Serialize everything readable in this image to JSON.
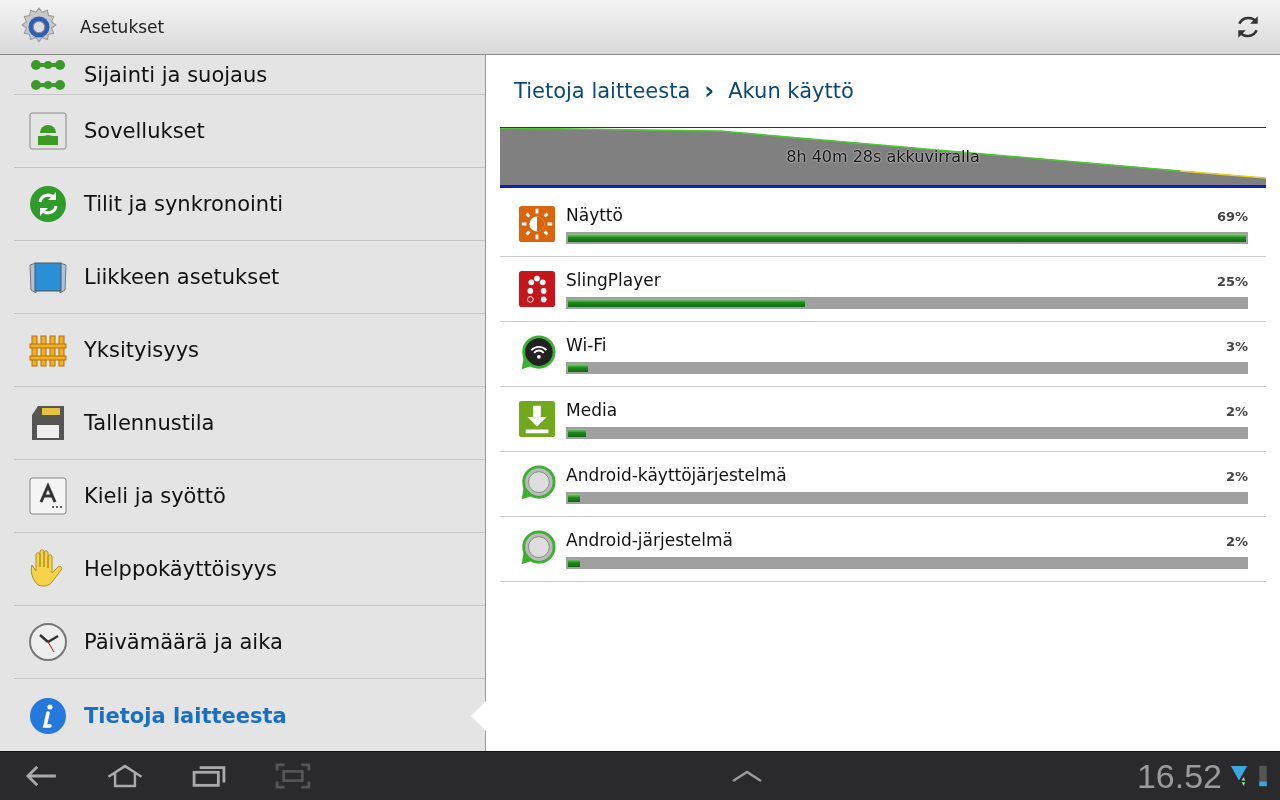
{
  "action_bar": {
    "title": "Asetukset"
  },
  "sidebar": {
    "items": [
      {
        "label": "Sijainti ja suojaus",
        "selected": false
      },
      {
        "label": "Sovellukset",
        "selected": false
      },
      {
        "label": "Tilit ja synkronointi",
        "selected": false
      },
      {
        "label": "Liikkeen asetukset",
        "selected": false
      },
      {
        "label": "Yksityisyys",
        "selected": false
      },
      {
        "label": "Tallennustila",
        "selected": false
      },
      {
        "label": "Kieli ja syöttö",
        "selected": false
      },
      {
        "label": "Helppokäyttöisyys",
        "selected": false
      },
      {
        "label": "Päivämäärä ja aika",
        "selected": false
      },
      {
        "label": "Tietoja laitteesta",
        "selected": true
      }
    ]
  },
  "breadcrumb": {
    "parent": "Tietoja laitteesta",
    "separator": "›",
    "current": "Akun käyttö"
  },
  "battery_graph": {
    "caption": "8h 40m 28s akkuvirralla"
  },
  "usage": [
    {
      "name": "Näyttö",
      "percent": "69%",
      "level": 1.0
    },
    {
      "name": "SlingPlayer",
      "percent": "25%",
      "level": 0.35
    },
    {
      "name": "Wi-Fi",
      "percent": "3%",
      "level": 0.03
    },
    {
      "name": "Media",
      "percent": "2%",
      "level": 0.027
    },
    {
      "name": "Android-käyttöjärjestelmä",
      "percent": "2%",
      "level": 0.018
    },
    {
      "name": "Android-järjestelmä",
      "percent": "2%",
      "level": 0.017
    }
  ],
  "system_bar": {
    "time": "16.52"
  }
}
